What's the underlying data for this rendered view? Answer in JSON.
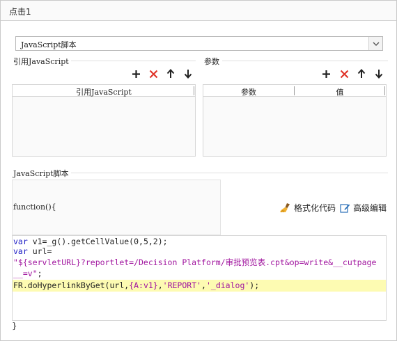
{
  "window": {
    "title": "点击1"
  },
  "script_type": {
    "selected": "JavaScript脚本"
  },
  "refs": {
    "label": "引用JavaScript",
    "column": "引用JavaScript"
  },
  "params": {
    "label": "参数",
    "columns": [
      "参数",
      "值"
    ]
  },
  "script": {
    "label": "JavaScript脚本",
    "function_header": "function(){",
    "format_label": "格式化代码",
    "advanced_label": "高级编辑",
    "code": {
      "l1_kw": "var",
      "l1_rest": " v1=_g().getCellValue(0,5,2);",
      "l2_kw": "var",
      "l2_rest": " url=",
      "l3_str": "\"${servletURL}?reportlet=/Decision Platform/审批预览表.cpt&op=write&__cutpage",
      "l4_str": "__=v\"",
      "l4_rest": ";",
      "l5_a": "FR.doHyperlinkByGet(url,",
      "l5_b": "{A:v1}",
      "l5_c": ",",
      "l5_d": "'REPORT'",
      "l5_e": ",",
      "l5_f": "'_dialog'",
      "l5_g": ");"
    },
    "closing": "}"
  },
  "icons": {
    "add": "plus-icon",
    "delete": "red-x-icon",
    "up": "arrow-up-icon",
    "down": "arrow-down-icon",
    "format": "broom-icon",
    "edit": "edit-icon",
    "dropdown": "chevron-down-icon"
  },
  "colors": {
    "delete": "#e0362c",
    "keyword": "#1c1cc4",
    "string": "#a1169f",
    "highlight": "#fdfbb2"
  }
}
